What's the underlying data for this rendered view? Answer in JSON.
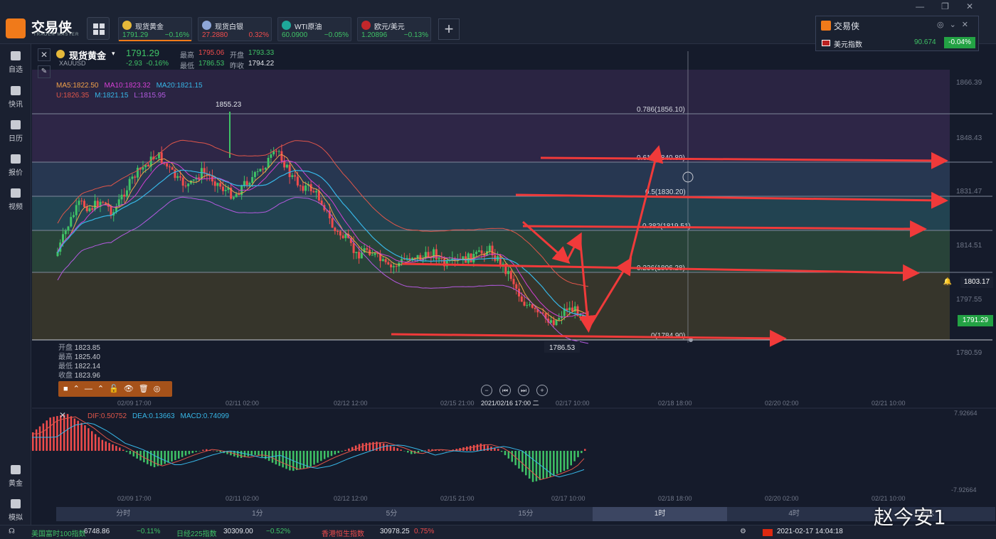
{
  "app": {
    "name": "交易侠",
    "subtitle": "TRADER MASTER",
    "window_controls": [
      "—",
      "❐",
      "✕"
    ]
  },
  "tickers": [
    {
      "name": "现货黄金",
      "price": "1791.29",
      "change": "−0.16%",
      "price_color": "#3fc266",
      "change_color": "#3fc266",
      "icon_color": "#e6b93a",
      "active": true
    },
    {
      "name": "现货白银",
      "price": "27.2880",
      "change": "0.32%",
      "price_color": "#f04c4c",
      "change_color": "#f04c4c",
      "icon_color": "#8ea6d8",
      "active": false
    },
    {
      "name": "WTI原油",
      "price": "60.0900",
      "change": "−0.05%",
      "price_color": "#3fc266",
      "change_color": "#3fc266",
      "icon_color": "#1ea79a",
      "active": false
    },
    {
      "name": "欧元/美元",
      "price": "1.20896",
      "change": "−0.13%",
      "price_color": "#3fc266",
      "change_color": "#3fc266",
      "icon_color": "#c3272b",
      "active": false
    }
  ],
  "widget": {
    "title": "交易侠",
    "icons": [
      "◎",
      "⌄",
      "✕"
    ],
    "instrument": "美元指数",
    "price": "90.674",
    "change": "-0.04%"
  },
  "sidebar": {
    "items": [
      {
        "label": "自选",
        "icon": "bookmark-icon"
      },
      {
        "label": "快讯",
        "icon": "news-icon"
      },
      {
        "label": "日历",
        "icon": "calendar-icon"
      },
      {
        "label": "报价",
        "icon": "quote-icon"
      },
      {
        "label": "视频",
        "icon": "video-icon"
      }
    ],
    "bottom_items": [
      {
        "label": "黄金",
        "icon": "gold-icon"
      },
      {
        "label": "模拟",
        "icon": "wallet-icon"
      }
    ]
  },
  "chart": {
    "symbol_name": "现货黄金",
    "symbol_code": "XAUUSD",
    "price": "1791.29",
    "change": "-2.93",
    "change_pct": "-0.16%",
    "high_label": "最高",
    "high": "1795.06",
    "open_label": "开盘",
    "open": "1793.33",
    "low_label": "最低",
    "low": "1786.53",
    "prev_close_label": "昨收",
    "prev_close": "1794.22",
    "ma_line": [
      {
        "text": "MA5:1822.50",
        "color": "#f0a14a"
      },
      {
        "text": "MA10:1823.32",
        "color": "#d440d4"
      },
      {
        "text": "MA20:1821.15",
        "color": "#37b6e6"
      }
    ],
    "boll_line": [
      {
        "text": "U:1826.35",
        "color": "#e0564a"
      },
      {
        "text": "M:1821.15",
        "color": "#37b6e6"
      },
      {
        "text": "L:1815.95",
        "color": "#b35ae0"
      }
    ],
    "peak_label": "1855.23",
    "trough_label": "1786.53",
    "hover_ohlc": [
      {
        "label": "开盘",
        "value": "1823.85"
      },
      {
        "label": "最高",
        "value": "1825.40"
      },
      {
        "label": "最低",
        "value": "1822.14"
      },
      {
        "label": "收盘",
        "value": "1823.96"
      }
    ],
    "toolbar_icons": [
      "■",
      "⌃",
      "—",
      "⌃",
      "🔓",
      "👁",
      "🗑",
      "◎"
    ],
    "nav_icons": [
      "−",
      "⏮",
      "⏭",
      "+"
    ],
    "fib_levels": [
      "0.786(1856.10)",
      "0.618(1840.89)",
      "0.5(1830.20)",
      "0.382(1819.51)",
      "0.236(1806.28)",
      "0(1784.90)"
    ],
    "y_axis": [
      "1866.39",
      "1848.43",
      "1831.47",
      "1814.51",
      "1797.55",
      "1780.59"
    ],
    "bell_price": "1803.17",
    "last_price_tag": "1791.29",
    "x_axis": [
      "02/09 17:00",
      "02/11 02:00",
      "02/12 12:00",
      "02/15 21:00",
      "2021/02/16 17:00 二",
      "02/17 10:00",
      "02/18 18:00",
      "02/20 02:00",
      "02/21 10:00"
    ],
    "macd_legend": [
      {
        "text": "DIF:0.50752",
        "color": "#e0564a"
      },
      {
        "text": "DEA:0.13663",
        "color": "#37b6e6"
      },
      {
        "text": "MACD:0.74099",
        "color": "#37b6e6"
      }
    ],
    "macd_axis_top": "7.92664",
    "macd_axis_bottom": "-7.92664",
    "macd_x_axis": [
      "02/09 17:00",
      "02/11 02:00",
      "02/12 12:00",
      "02/15 21:00",
      "02/17 10:00",
      "02/18 18:00",
      "02/20 02:00",
      "02/21 10:00"
    ],
    "candle_shape": [
      0.58,
      0.42,
      0.3,
      0.33,
      0.28,
      0.36,
      0.24,
      0.14,
      0.08,
      0.02,
      0.1,
      0.18,
      0.2,
      0.12,
      0.16,
      0.22,
      0.26,
      0.18,
      0.14,
      0.06,
      0.0,
      0.14,
      0.2,
      0.22,
      0.3,
      0.46,
      0.5,
      0.6,
      0.56,
      0.62,
      0.68,
      0.64,
      0.6,
      0.62,
      0.58,
      0.66,
      0.64,
      0.62,
      0.6,
      0.56,
      0.64,
      0.72,
      0.86,
      0.92,
      0.96,
      0.98,
      0.9,
      0.92,
      0.94
    ],
    "macd_values": [
      0.5,
      0.9,
      1.0,
      0.7,
      0.3,
      0.1,
      -0.2,
      -0.45,
      -0.3,
      -0.1,
      0.05,
      -0.05,
      -0.2,
      -0.1,
      -0.35,
      -0.55,
      -0.45,
      -0.2,
      0.0,
      0.2,
      0.25,
      0.1,
      -0.1,
      0.05,
      0.0,
      0.1,
      0.2,
      0.05,
      -0.4,
      -0.85,
      -0.7,
      -0.5,
      0.05
    ]
  },
  "timeframes": [
    "分时",
    "1分",
    "5分",
    "15分",
    "1时",
    "4时",
    "日K"
  ],
  "active_timeframe": 4,
  "status": {
    "items": [
      {
        "name": "美国富时100指数",
        "price": "6748.86",
        "change": "−0.11%",
        "color": "#3fc266"
      },
      {
        "name": "日经225指数",
        "price": "30309.00",
        "change": "−0.52%",
        "color": "#3fc266"
      },
      {
        "name": "香港恒生指数",
        "price": "30978.25",
        "change": "0.75%",
        "color": "#f04c4c"
      }
    ],
    "datetime": "2021-02-17 14:04:18"
  },
  "watermark": "赵今安1"
}
